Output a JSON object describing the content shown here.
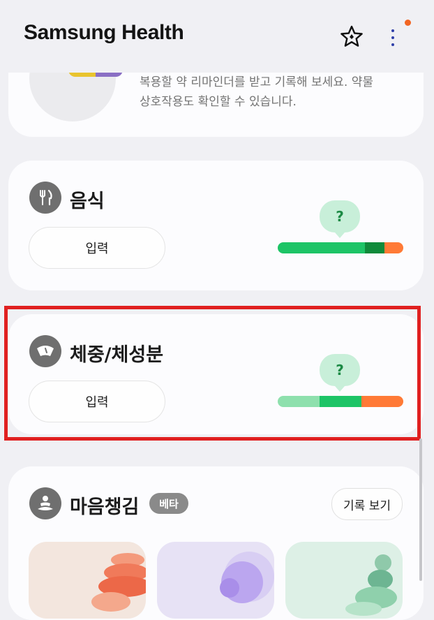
{
  "header": {
    "title": "Samsung Health",
    "icons": [
      "star-icon",
      "more-vert-icon"
    ],
    "notification_color": "#f26522"
  },
  "medication": {
    "description_line1": "복용할 약 리마인더를 받고 기록해 보세요. 약물",
    "description_line2": "상호작용도 확인할 수 있습니다."
  },
  "food": {
    "title": "음식",
    "input_label": "입력",
    "gauge_label": "?",
    "icon": "fork-knife-icon"
  },
  "weight": {
    "title": "체중/체성분",
    "input_label": "입력",
    "gauge_label": "?",
    "icon": "scale-icon",
    "highlighted": true
  },
  "mindfulness": {
    "title": "마음챙김",
    "badge": "베타",
    "history_label": "기록 보기",
    "icon": "meditation-icon"
  },
  "colors": {
    "accent_green": "#1dc466",
    "dark_green": "#0f8a3a",
    "orange": "#ff7a36",
    "light_green": "#8ee0ad",
    "highlight_red": "#e02020"
  }
}
